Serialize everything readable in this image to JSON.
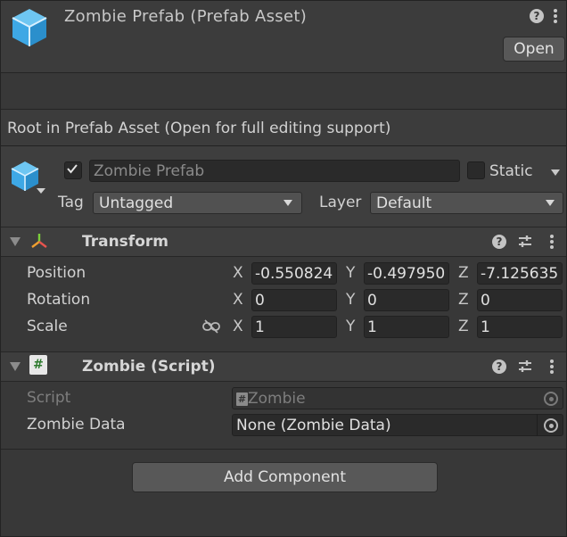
{
  "header": {
    "title": "Zombie Prefab (Prefab Asset)",
    "open_label": "Open",
    "help_glyph": "?"
  },
  "notice": {
    "text": "Root in Prefab Asset (Open for full editing support)"
  },
  "gameobject": {
    "active": true,
    "name": "Zombie Prefab",
    "static_label": "Static",
    "static_checked": false,
    "tag_label": "Tag",
    "tag_value": "Untagged",
    "layer_label": "Layer",
    "layer_value": "Default"
  },
  "transform": {
    "title": "Transform",
    "rows": [
      {
        "label": "Position",
        "x": "-0.550824",
        "y": "-0.497950",
        "z": "-7.125635"
      },
      {
        "label": "Rotation",
        "x": "0",
        "y": "0",
        "z": "0"
      },
      {
        "label": "Scale",
        "x": "1",
        "y": "1",
        "z": "1"
      }
    ],
    "axis_x": "X",
    "axis_y": "Y",
    "axis_z": "Z"
  },
  "script_component": {
    "title": "Zombie (Script)",
    "script_label": "Script",
    "script_value": "Zombie",
    "data_label": "Zombie Data",
    "data_value": "None (Zombie Data)",
    "hash_glyph": "#"
  },
  "add_component_label": "Add Component",
  "icons": [
    "prefab-cube-icon",
    "help-icon",
    "kebab-menu-icon",
    "transform-axes-icon",
    "script-hash-icon",
    "preset-sliders-icon",
    "constrain-link-icon",
    "object-picker-icon"
  ],
  "colors": {
    "panel": "#383838",
    "field": "#2a2a2a",
    "button": "#585858",
    "prefab_blue": "#3ea8e5",
    "axis_green": "#7ccf3a",
    "axis_red": "#e8544e",
    "axis_orange": "#f0a030"
  }
}
